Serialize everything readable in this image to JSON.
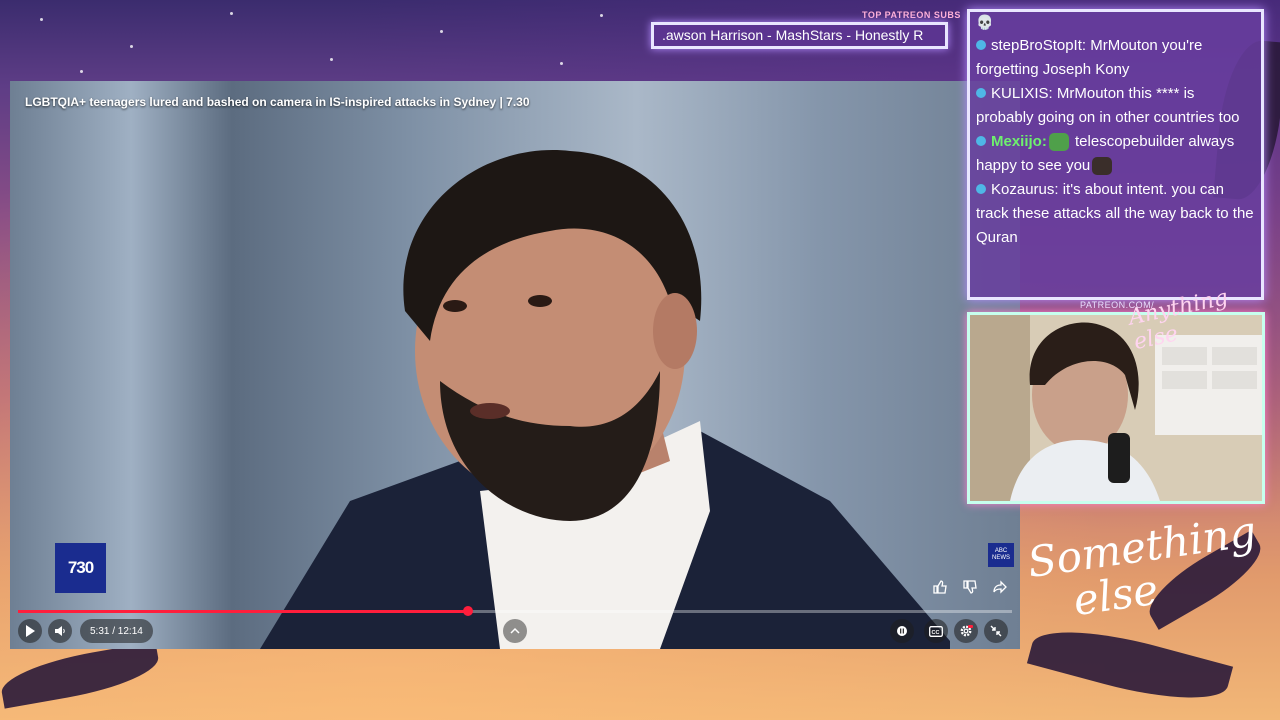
{
  "ticker": {
    "label": "TOP PATREON SUBS",
    "text": ".awson Harrison - MashStars - Honestly R"
  },
  "video": {
    "title": "LGBTQIA+ teenagers lured and bashed on camera in IS-inspired attacks in Sydney | 7.30",
    "channel_logo": "730",
    "news_badge": "ABC NEWS",
    "time": "5:31 / 12:14",
    "progress_fraction": 0.453,
    "icons": [
      "like-icon",
      "dislike-icon",
      "share-icon",
      "play-icon",
      "volume-icon",
      "chevron-up-icon",
      "autoplay-toggle-icon",
      "captions-icon",
      "settings-icon",
      "exit-fullscreen-icon"
    ],
    "progress_color": "#ff1e3c"
  },
  "chat": {
    "messages": [
      {
        "user": "stepBroStopIt:",
        "text": " MrMouton you're forgetting Joseph Kony"
      },
      {
        "user": "KULIXIS:",
        "text": " MrMouton this **** is probably going on in other countries too"
      },
      {
        "user": "Mexiijo:",
        "text": " telescopebuilder always happy to see you",
        "user_color": "#6ef06e"
      },
      {
        "user": "Kozaurus:",
        "text": " it's about intent. you can track these attacks all the way back to the Quran"
      }
    ]
  },
  "overlay": {
    "patreon_url": "PATREON.COM/"
  },
  "colors": {
    "chat_bg": "#683e9e",
    "frame": "#e9e6ff",
    "accent": "#b58cff"
  }
}
